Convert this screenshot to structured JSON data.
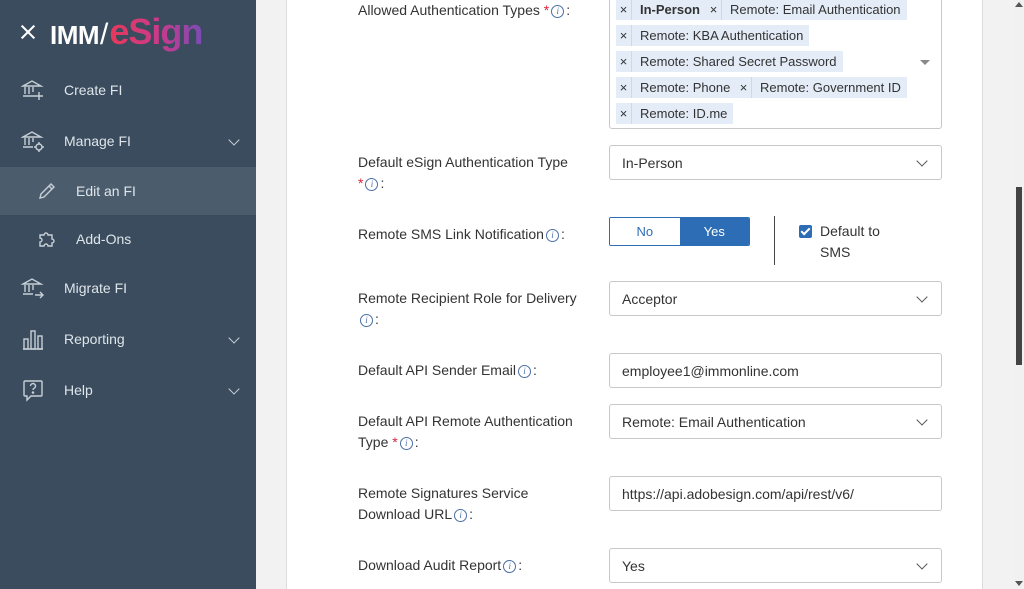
{
  "brand": {
    "logo_left": "IMM",
    "logo_right": "eSign"
  },
  "sidebar": {
    "items": [
      {
        "label": "Create FI",
        "icon": "bank-plus-icon"
      },
      {
        "label": "Manage FI",
        "icon": "bank-gear-icon"
      },
      {
        "label": "Edit an FI",
        "icon": "pencil-icon"
      },
      {
        "label": "Add-Ons",
        "icon": "puzzle-icon"
      },
      {
        "label": "Migrate FI",
        "icon": "bank-arrow-icon"
      },
      {
        "label": "Reporting",
        "icon": "bar-chart-icon"
      },
      {
        "label": "Help",
        "icon": "question-icon"
      }
    ]
  },
  "form": {
    "allowed_auth": {
      "label": "Allowed Authentication Types",
      "tags": [
        "In-Person",
        "Remote: Email Authentication",
        "Remote: KBA Authentication",
        "Remote: Shared Secret Password",
        "Remote: Phone",
        "Remote: Government ID",
        "Remote: ID.me"
      ]
    },
    "default_auth": {
      "label_line1": "Default eSign Authentication Type",
      "value": "In-Person"
    },
    "sms_link": {
      "label": "Remote SMS Link Notification",
      "option_no": "No",
      "option_yes": "Yes",
      "selected": "Yes",
      "checkbox_label": "Default to SMS",
      "checked": true
    },
    "recipient_role": {
      "label_line1": "Remote Recipient Role for Delivery",
      "value": "Acceptor"
    },
    "sender_email": {
      "label": "Default API Sender Email",
      "value": "employee1@immonline.com"
    },
    "api_remote_auth": {
      "label_line1": "Default API Remote Authentication",
      "label_line2": "Type",
      "value": "Remote: Email Authentication"
    },
    "download_url": {
      "label_line1": "Remote Signatures Service",
      "label_line2": "Download URL",
      "value": "https://api.adobesign.com/api/rest/v6/"
    },
    "audit_report": {
      "label": "Download Audit Report",
      "value": "Yes"
    }
  },
  "colors": {
    "sidebar_bg": "#3a4c5d",
    "accent": "#2d6db5",
    "required": "#d9263a",
    "tag_bg": "#e4ecf7"
  }
}
